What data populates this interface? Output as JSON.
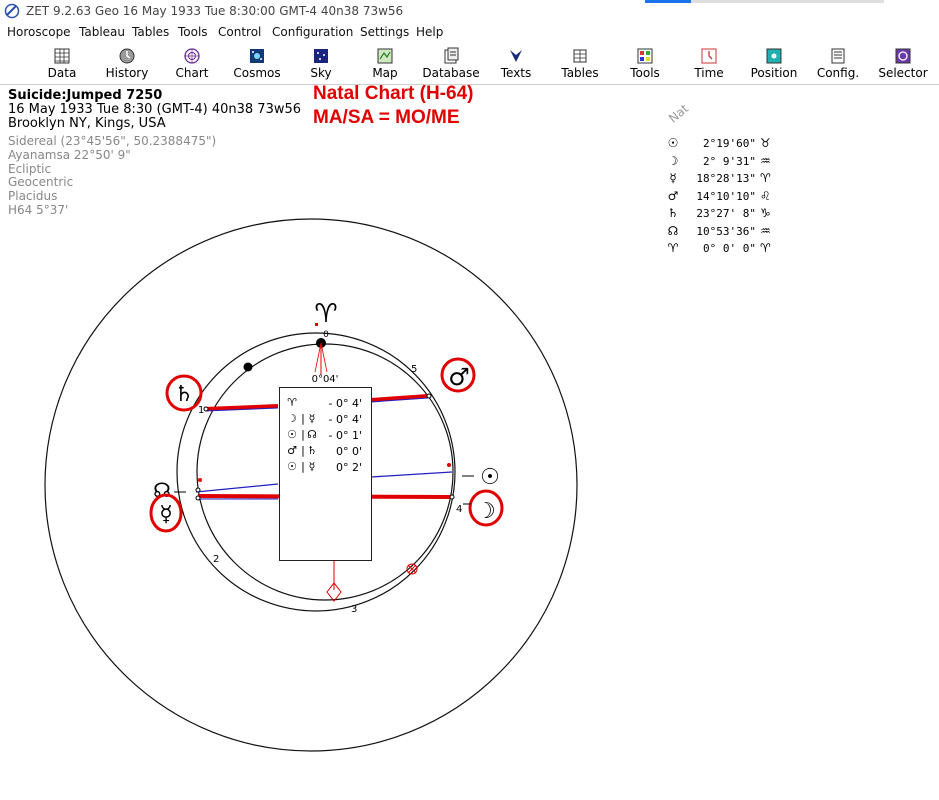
{
  "window": {
    "title": "ZET 9.2.63 Geo   16 May 1933   Tue    8:30:00 GMT-4 40n38  73w56"
  },
  "menu": [
    "Horoscope",
    "Tableau",
    "Tables",
    "Tools",
    "Control",
    "Configuration",
    "Settings",
    "Help"
  ],
  "toolbar": [
    {
      "label": "Data",
      "icon": "data-grid-icon"
    },
    {
      "label": "History",
      "icon": "history-icon"
    },
    {
      "label": "Chart",
      "icon": "chart-wheel-icon"
    },
    {
      "label": "Cosmos",
      "icon": "cosmos-icon"
    },
    {
      "label": "Sky",
      "icon": "sky-icon"
    },
    {
      "label": "Map",
      "icon": "map-icon"
    },
    {
      "label": "Database",
      "icon": "database-icon"
    },
    {
      "label": "Texts",
      "icon": "texts-icon"
    },
    {
      "label": "Tables",
      "icon": "tables-icon"
    },
    {
      "label": "Tools",
      "icon": "tools-icon"
    },
    {
      "label": "Time",
      "icon": "time-icon"
    },
    {
      "label": "Position",
      "icon": "position-icon"
    },
    {
      "label": "Config.",
      "icon": "config-icon"
    },
    {
      "label": "Selector",
      "icon": "selector-icon"
    }
  ],
  "chart_info": {
    "name": "Suicide:Jumped 7250",
    "datetime": "16 May 1933  Tue   8:30 (GMT-4) 40n38  73w56",
    "place": "Brooklyn NY, Kings, USA",
    "settings": [
      "Sidereal (23°45'56\", 50.2388475\")",
      "Ayanamsa 22°50' 9\"",
      "Ecliptic",
      "Geocentric",
      "Placidus",
      "H64   5°37'"
    ]
  },
  "annotation": {
    "line1": "Natal Chart (H-64)",
    "line2": "MA/SA = MO/ME"
  },
  "positions": {
    "label": "Nat",
    "rows": [
      {
        "glyph": "☉",
        "value": "2°19'60\"",
        "sign": "♉"
      },
      {
        "glyph": "☽",
        "value": "2° 9'31\"",
        "sign": "♒"
      },
      {
        "glyph": "☿",
        "value": "18°28'13\"",
        "sign": "♈"
      },
      {
        "glyph": "♂",
        "value": "14°10'10\"",
        "sign": "♌"
      },
      {
        "glyph": "♄",
        "value": "23°27' 8\"",
        "sign": "♑"
      },
      {
        "glyph": "☊",
        "value": "10°53'36\"",
        "sign": "♒"
      },
      {
        "glyph": "♈",
        "value": "0° 0' 0\"",
        "sign": "♈"
      }
    ]
  },
  "wheel": {
    "aries_glyph": "♈",
    "aries_offset": "0°04'",
    "house_numbers": [
      "1",
      "2",
      "3",
      "4",
      "5"
    ],
    "planet_glyphs": {
      "saturn": "♄",
      "mars": "♂",
      "node": "☊",
      "mercury": "☿",
      "sun": "☉",
      "moon": "☽"
    }
  },
  "aspect_box": {
    "rows": [
      {
        "g1": "♈",
        "bar": "",
        "g2": "",
        "value": "- 0° 4'"
      },
      {
        "g1": "☽",
        "bar": "|",
        "g2": "☿",
        "value": "- 0° 4'"
      },
      {
        "g1": "☉",
        "bar": "|",
        "g2": "☊",
        "value": "- 0° 1'"
      },
      {
        "g1": "♂",
        "bar": "|",
        "g2": "♄",
        "value": "0° 0'"
      },
      {
        "g1": "☉",
        "bar": "|",
        "g2": "☿",
        "value": "0° 2'"
      }
    ]
  },
  "colors": {
    "highlight": "#e00000",
    "aspect_blue": "#2020c0",
    "border": "#222222"
  }
}
